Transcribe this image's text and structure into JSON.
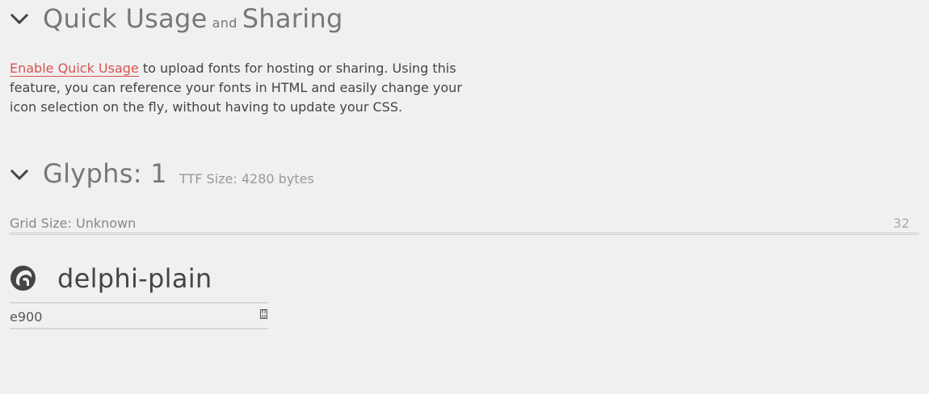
{
  "quick_usage": {
    "title_part1": "Quick Usage",
    "title_and": "and",
    "title_part2": "Sharing",
    "enable_link": "Enable Quick Usage",
    "description": " to upload fonts for hosting or sharing. Using this feature, you can reference your fonts in HTML and easily change your icon selection on the fly, without having to update your CSS."
  },
  "glyphs": {
    "title": "Glyphs: 1",
    "ttf_size": "TTF Size: 4280 bytes",
    "grid_label": "Grid Size: Unknown",
    "grid_value": "32"
  },
  "glyph_item": {
    "icon": "delphi-helmet-icon",
    "name": "delphi-plain",
    "code": "e900",
    "code_glyph": "E9 00"
  },
  "colors": {
    "accent_link": "#d9534f",
    "background": "#f0f0f0"
  }
}
